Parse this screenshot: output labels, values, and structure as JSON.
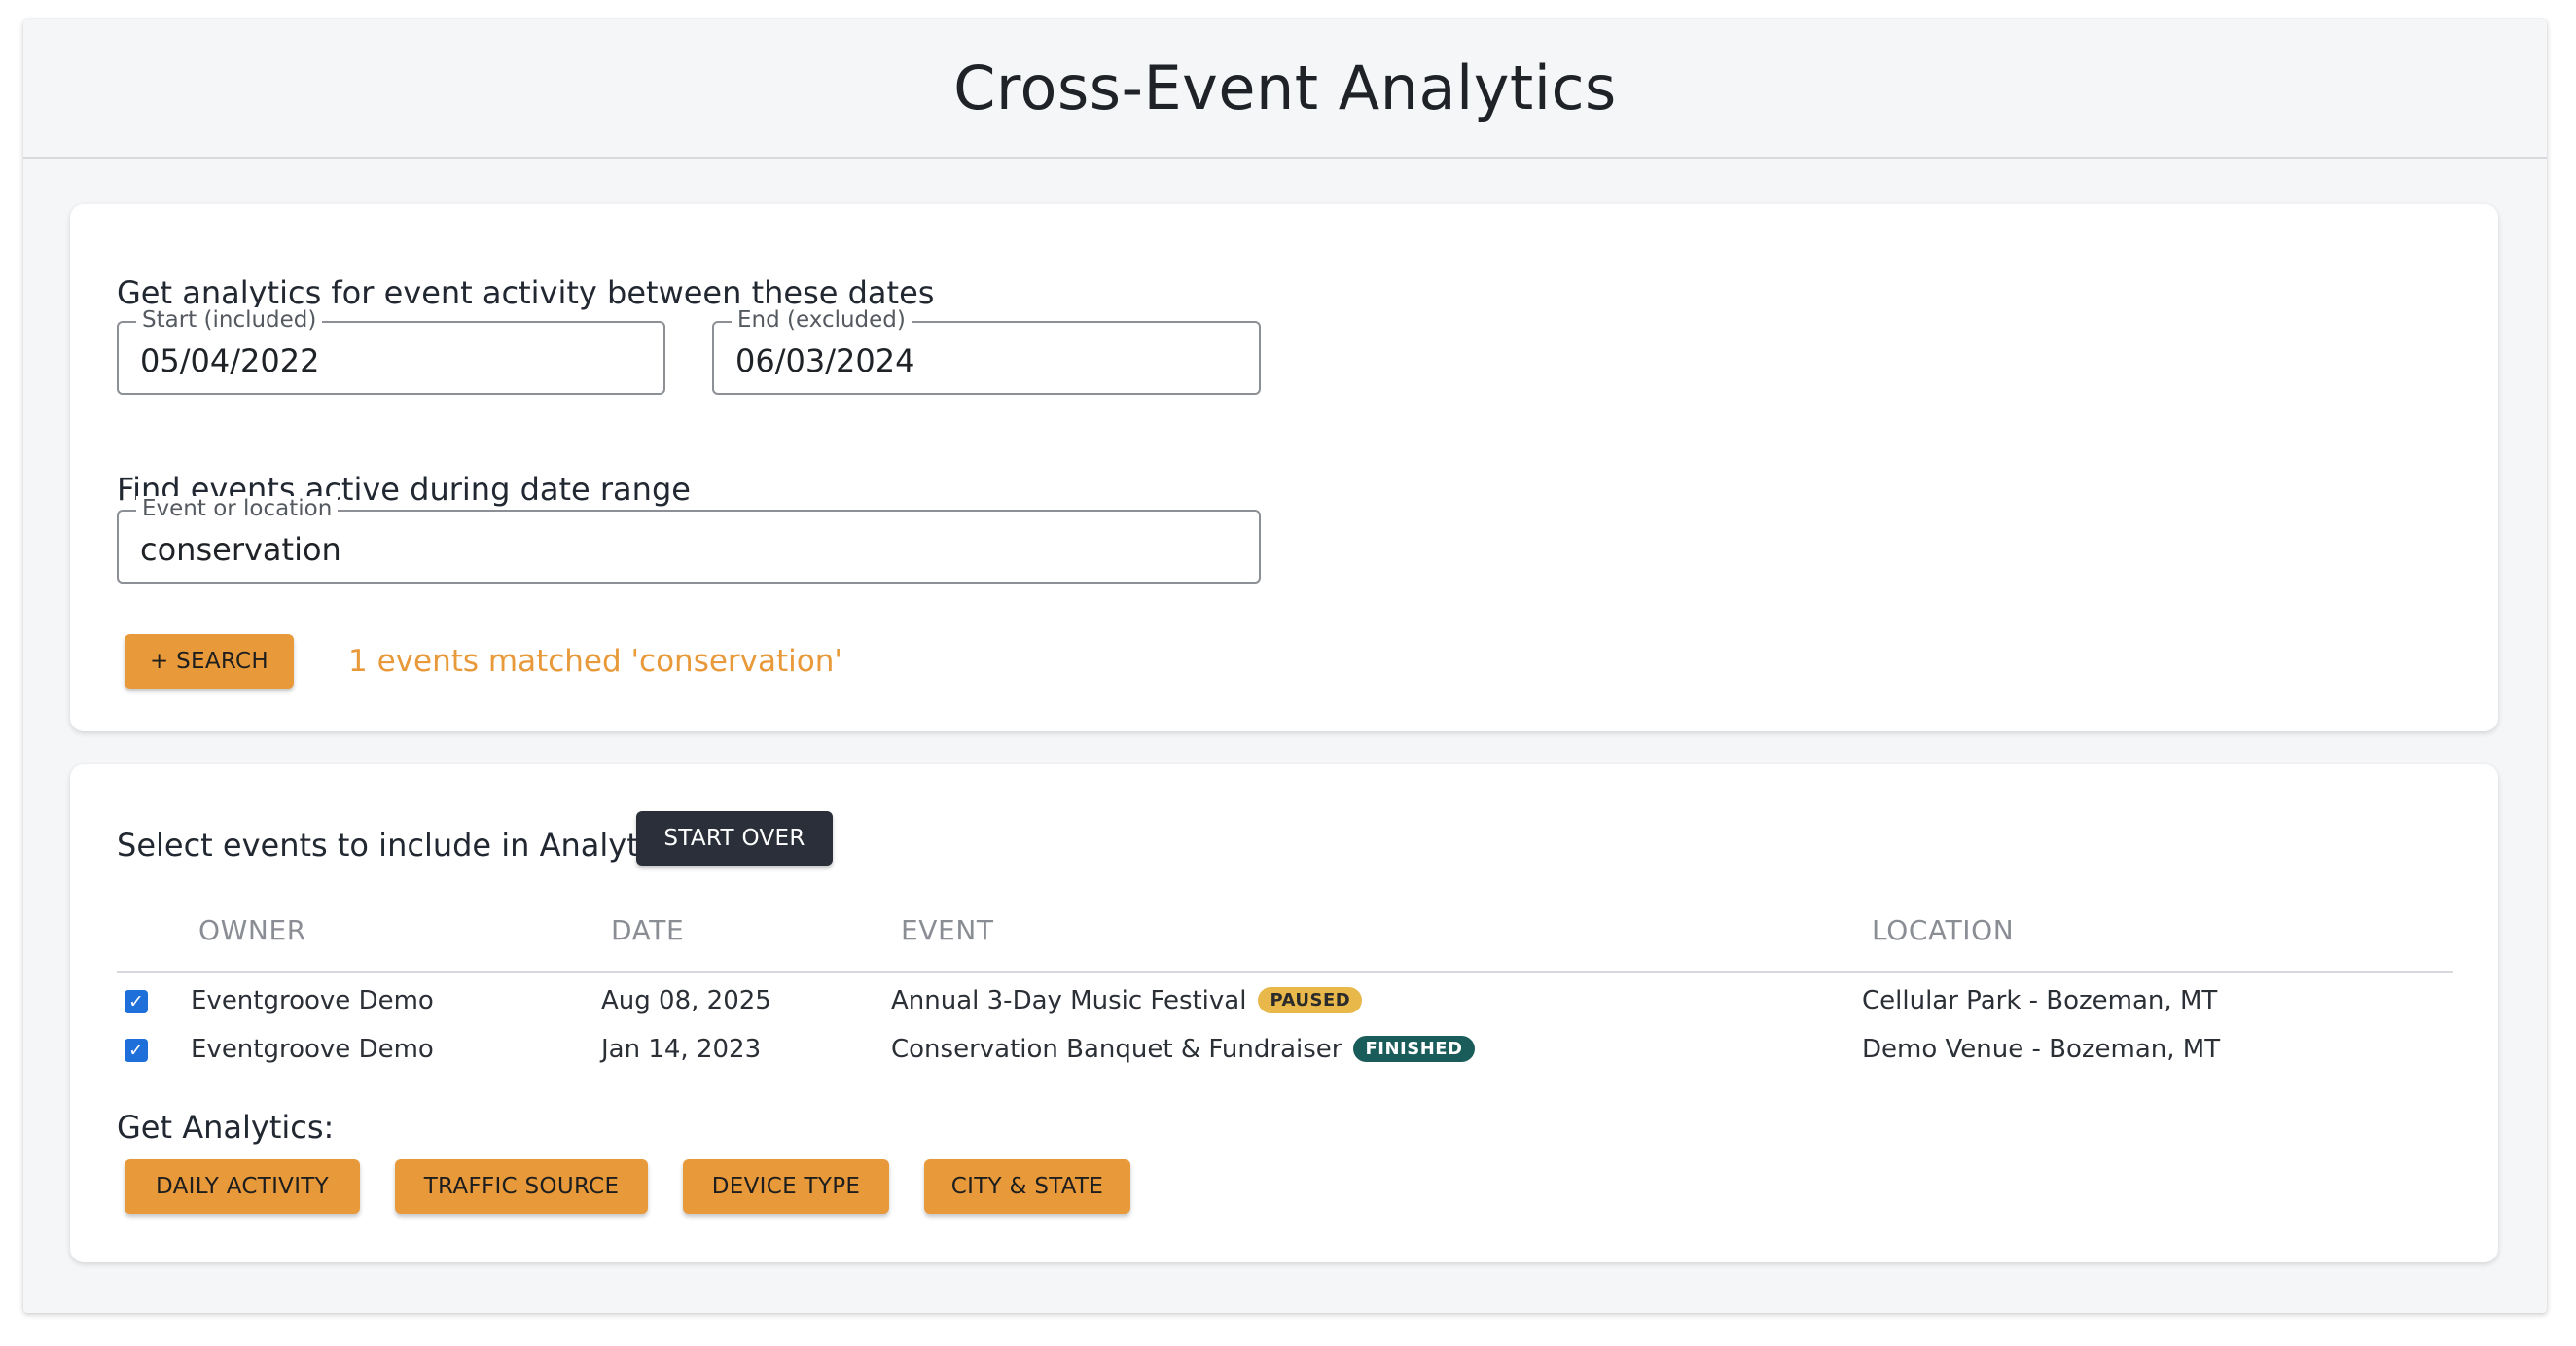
{
  "page": {
    "title": "Cross-Event Analytics"
  },
  "date_filter": {
    "label": "Get analytics for event activity between these dates",
    "start": {
      "legend": "Start (included)",
      "value": "05/04/2022"
    },
    "end": {
      "legend": "End (excluded)",
      "value": "06/03/2024"
    }
  },
  "event_search": {
    "label": "Find events active during date range",
    "field": {
      "legend": "Event or location",
      "value": "conservation"
    },
    "search_button": "+ SEARCH",
    "match_text": "1 events matched 'conservation'"
  },
  "selection": {
    "label": "Select events to include in Analytics:",
    "start_over_button": "START OVER",
    "columns": [
      "OWNER",
      "DATE",
      "EVENT",
      "LOCATION"
    ],
    "rows": [
      {
        "checked": true,
        "owner": "Eventgroove Demo",
        "date": "Aug 08, 2025",
        "event": "Annual 3-Day Music Festival",
        "status": "PAUSED",
        "location": "Cellular Park - Bozeman, MT"
      },
      {
        "checked": true,
        "owner": "Eventgroove Demo",
        "date": "Jan 14, 2023",
        "event": "Conservation Banquet & Fundraiser",
        "status": "FINISHED",
        "location": "Demo Venue - Bozeman, MT"
      }
    ]
  },
  "analytics": {
    "label": "Get Analytics:",
    "buttons": [
      "DAILY ACTIVITY",
      "TRAFFIC SOURCE",
      "DEVICE TYPE",
      "CITY & STATE"
    ]
  },
  "colors": {
    "accent_orange": "#e89939",
    "dark_button": "#2a2f3a",
    "badge_paused": "#e8b84b",
    "badge_finished": "#195c5a",
    "checkbox_blue": "#1e6fd9"
  }
}
